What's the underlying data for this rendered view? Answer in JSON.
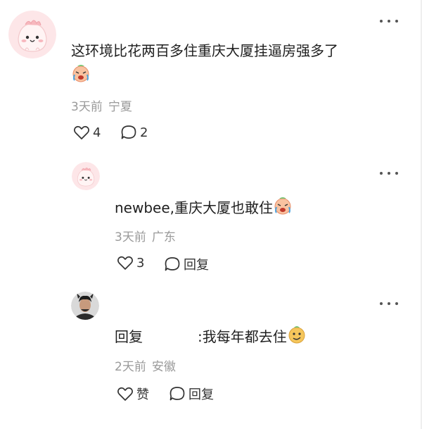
{
  "comments": [
    {
      "text": "这环境比花两百多住重庆大厦挂逼房强多了",
      "emoji_name": "crying-laughing-emoji",
      "time": "3天前",
      "location": "宁夏",
      "like_count": "4",
      "reply_count": "2"
    },
    {
      "text": "newbee,重庆大厦也敢住",
      "emoji_name": "crying-laughing-emoji",
      "time": "3天前",
      "location": "广东",
      "like_count": "3",
      "reply_label": "回复"
    },
    {
      "reply_prefix": "回复",
      "text": ":我每年都去住",
      "emoji_name": "smug-face-emoji",
      "time": "2天前",
      "location": "安徽",
      "like_label": "赞",
      "reply_label": "回复"
    }
  ],
  "colors": {
    "text": "#1f1f1f",
    "meta": "#9a9a9a",
    "icon": "#333333",
    "avatar_pink_bg": "#fde8ea"
  }
}
